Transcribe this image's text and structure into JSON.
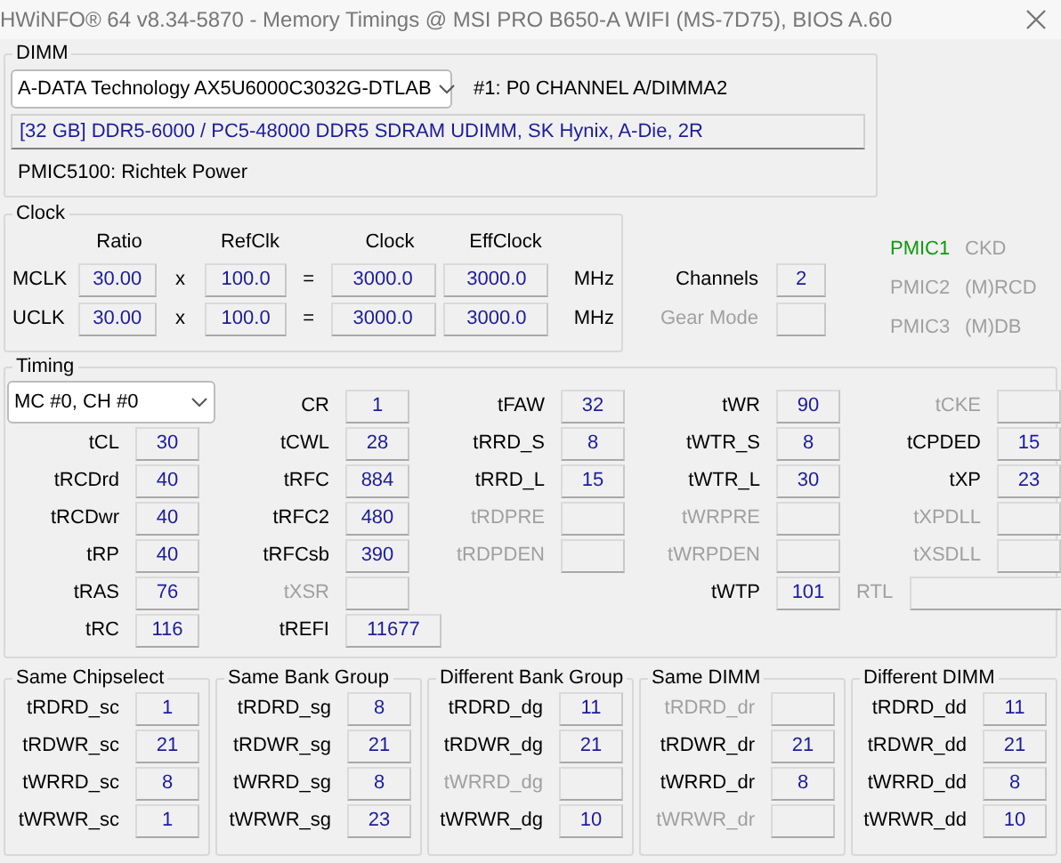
{
  "window": {
    "title": "HWiNFO® 64 v8.34-5870 - Memory Timings @ MSI PRO B650-A WIFI (MS-7D75), BIOS A.60"
  },
  "dimm": {
    "title": "DIMM",
    "module": "A-DATA Technology AX5U6000C3032G-DTLAB",
    "slot": "#1: P0 CHANNEL A/DIMMA2",
    "description": "[32 GB] DDR5-6000 / PC5-48000 DDR5 SDRAM UDIMM, SK Hynix, A-Die, 2R",
    "pmic": "PMIC5100: Richtek Power"
  },
  "clock": {
    "title": "Clock",
    "columns": [
      "Ratio",
      "RefClk",
      "Clock",
      "EffClock"
    ],
    "rows": [
      {
        "name": "MCLK",
        "ratio": "30.00",
        "x": "x",
        "refclk": "100.0",
        "eq": "=",
        "clock": "3000.0",
        "effclock": "3000.0",
        "unit": "MHz"
      },
      {
        "name": "UCLK",
        "ratio": "30.00",
        "x": "x",
        "refclk": "100.0",
        "eq": "=",
        "clock": "3000.0",
        "effclock": "3000.0",
        "unit": "MHz"
      }
    ],
    "channels": {
      "label": "Channels",
      "value": "2",
      "disabled": false
    },
    "gear_mode": {
      "label": "Gear Mode",
      "disabled": true
    }
  },
  "pmics": [
    {
      "name": "PMIC1",
      "role": "CKD",
      "active": true
    },
    {
      "name": "PMIC2",
      "role": "(M)RCD",
      "active": false
    },
    {
      "name": "PMIC3",
      "role": "(M)DB",
      "active": false
    }
  ],
  "timing": {
    "title": "Timing",
    "controller": "MC #0, CH #0",
    "rows": [
      [
        null,
        {
          "label": "CR",
          "value": "1",
          "disabled": false,
          "kind": "normal"
        },
        {
          "label": "tFAW",
          "value": "32",
          "disabled": false,
          "kind": "normal"
        },
        {
          "label": "tWR",
          "value": "90",
          "disabled": false,
          "kind": "normal"
        },
        {
          "label": "tCKE",
          "disabled": true,
          "kind": "normal"
        }
      ],
      [
        {
          "label": "tCL",
          "value": "30",
          "disabled": false,
          "kind": "normal"
        },
        {
          "label": "tCWL",
          "value": "28",
          "disabled": false,
          "kind": "normal"
        },
        {
          "label": "tRRD_S",
          "value": "8",
          "disabled": false,
          "kind": "normal"
        },
        {
          "label": "tWTR_S",
          "value": "8",
          "disabled": false,
          "kind": "normal"
        },
        {
          "label": "tCPDED",
          "value": "15",
          "disabled": false,
          "kind": "normal"
        }
      ],
      [
        {
          "label": "tRCDrd",
          "value": "40",
          "disabled": false,
          "kind": "normal"
        },
        {
          "label": "tRFC",
          "value": "884",
          "disabled": false,
          "kind": "normal"
        },
        {
          "label": "tRRD_L",
          "value": "15",
          "disabled": false,
          "kind": "normal"
        },
        {
          "label": "tWTR_L",
          "value": "30",
          "disabled": false,
          "kind": "normal"
        },
        {
          "label": "tXP",
          "value": "23",
          "disabled": false,
          "kind": "normal"
        }
      ],
      [
        {
          "label": "tRCDwr",
          "value": "40",
          "disabled": false,
          "kind": "normal"
        },
        {
          "label": "tRFC2",
          "value": "480",
          "disabled": false,
          "kind": "normal"
        },
        {
          "label": "tRDPRE",
          "disabled": true,
          "kind": "normal"
        },
        {
          "label": "tWRPRE",
          "disabled": true,
          "kind": "normal"
        },
        {
          "label": "tXPDLL",
          "disabled": true,
          "kind": "normal"
        }
      ],
      [
        {
          "label": "tRP",
          "value": "40",
          "disabled": false,
          "kind": "normal"
        },
        {
          "label": "tRFCsb",
          "value": "390",
          "disabled": false,
          "kind": "normal"
        },
        {
          "label": "tRDPDEN",
          "disabled": true,
          "kind": "normal"
        },
        {
          "label": "tWRPDEN",
          "disabled": true,
          "kind": "normal"
        },
        {
          "label": "tXSDLL",
          "disabled": true,
          "kind": "normal"
        }
      ],
      [
        {
          "label": "tRAS",
          "value": "76",
          "disabled": false,
          "kind": "normal"
        },
        {
          "label": "tXSR",
          "disabled": true,
          "kind": "normal"
        },
        null,
        {
          "label": "tWTP",
          "value": "101",
          "disabled": false,
          "kind": "normal"
        },
        {
          "label": "RTL",
          "disabled": true,
          "kind": "span"
        }
      ],
      [
        {
          "label": "tRC",
          "value": "116",
          "disabled": false,
          "kind": "normal"
        },
        {
          "label": "tREFI",
          "value": "11677",
          "disabled": false,
          "kind": "wide"
        },
        null,
        null,
        null
      ]
    ]
  },
  "groups": [
    {
      "title": "Same Chipselect",
      "items": [
        {
          "label": "tRDRD_sc",
          "value": "1",
          "disabled": false
        },
        {
          "label": "tRDWR_sc",
          "value": "21",
          "disabled": false
        },
        {
          "label": "tWRRD_sc",
          "value": "8",
          "disabled": false
        },
        {
          "label": "tWRWR_sc",
          "value": "1",
          "disabled": false
        }
      ]
    },
    {
      "title": "Same Bank Group",
      "items": [
        {
          "label": "tRDRD_sg",
          "value": "8",
          "disabled": false
        },
        {
          "label": "tRDWR_sg",
          "value": "21",
          "disabled": false
        },
        {
          "label": "tWRRD_sg",
          "value": "8",
          "disabled": false
        },
        {
          "label": "tWRWR_sg",
          "value": "23",
          "disabled": false
        }
      ]
    },
    {
      "title": "Different Bank Group",
      "items": [
        {
          "label": "tRDRD_dg",
          "value": "11",
          "disabled": false
        },
        {
          "label": "tRDWR_dg",
          "value": "21",
          "disabled": false
        },
        {
          "label": "tWRRD_dg",
          "disabled": true
        },
        {
          "label": "tWRWR_dg",
          "value": "10",
          "disabled": false
        }
      ]
    },
    {
      "title": "Same DIMM",
      "items": [
        {
          "label": "tRDRD_dr",
          "disabled": true
        },
        {
          "label": "tRDWR_dr",
          "value": "21",
          "disabled": false
        },
        {
          "label": "tWRRD_dr",
          "value": "8",
          "disabled": false
        },
        {
          "label": "tWRWR_dr",
          "disabled": true
        }
      ]
    },
    {
      "title": "Different DIMM",
      "items": [
        {
          "label": "tRDRD_dd",
          "value": "11",
          "disabled": false
        },
        {
          "label": "tRDWR_dd",
          "value": "21",
          "disabled": false
        },
        {
          "label": "tWRRD_dd",
          "value": "8",
          "disabled": false
        },
        {
          "label": "tWRWR_dd",
          "value": "10",
          "disabled": false
        }
      ]
    }
  ]
}
